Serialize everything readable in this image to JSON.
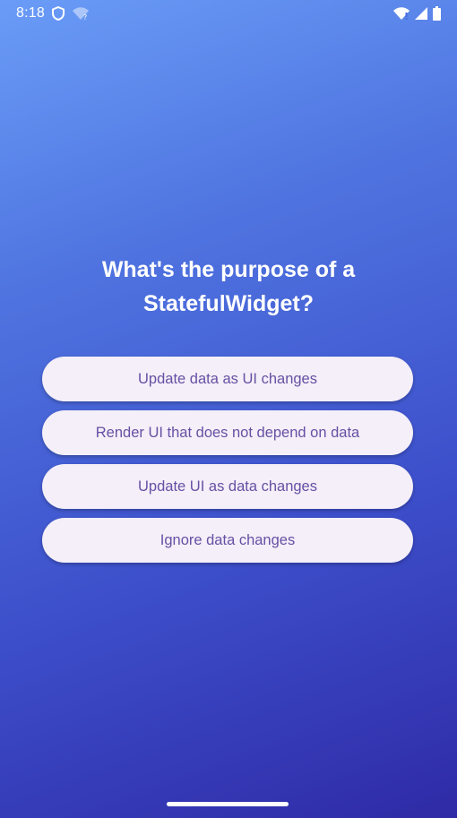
{
  "status_bar": {
    "time": "8:18",
    "icons": [
      "shield-icon",
      "wifi-question-icon",
      "wifi-alert-icon",
      "cellular-signal-icon",
      "battery-icon"
    ]
  },
  "quiz": {
    "question": "What's the purpose of a StatefulWidget?",
    "answers": [
      "Update data as UI changes",
      "Render UI that does not depend on data",
      "Update UI as data changes",
      "Ignore data changes"
    ]
  },
  "colors": {
    "gradient_start": "#6a9cf7",
    "gradient_end": "#2f2aa6",
    "button_bg": "#f4eff8",
    "button_text": "#6750a4"
  }
}
